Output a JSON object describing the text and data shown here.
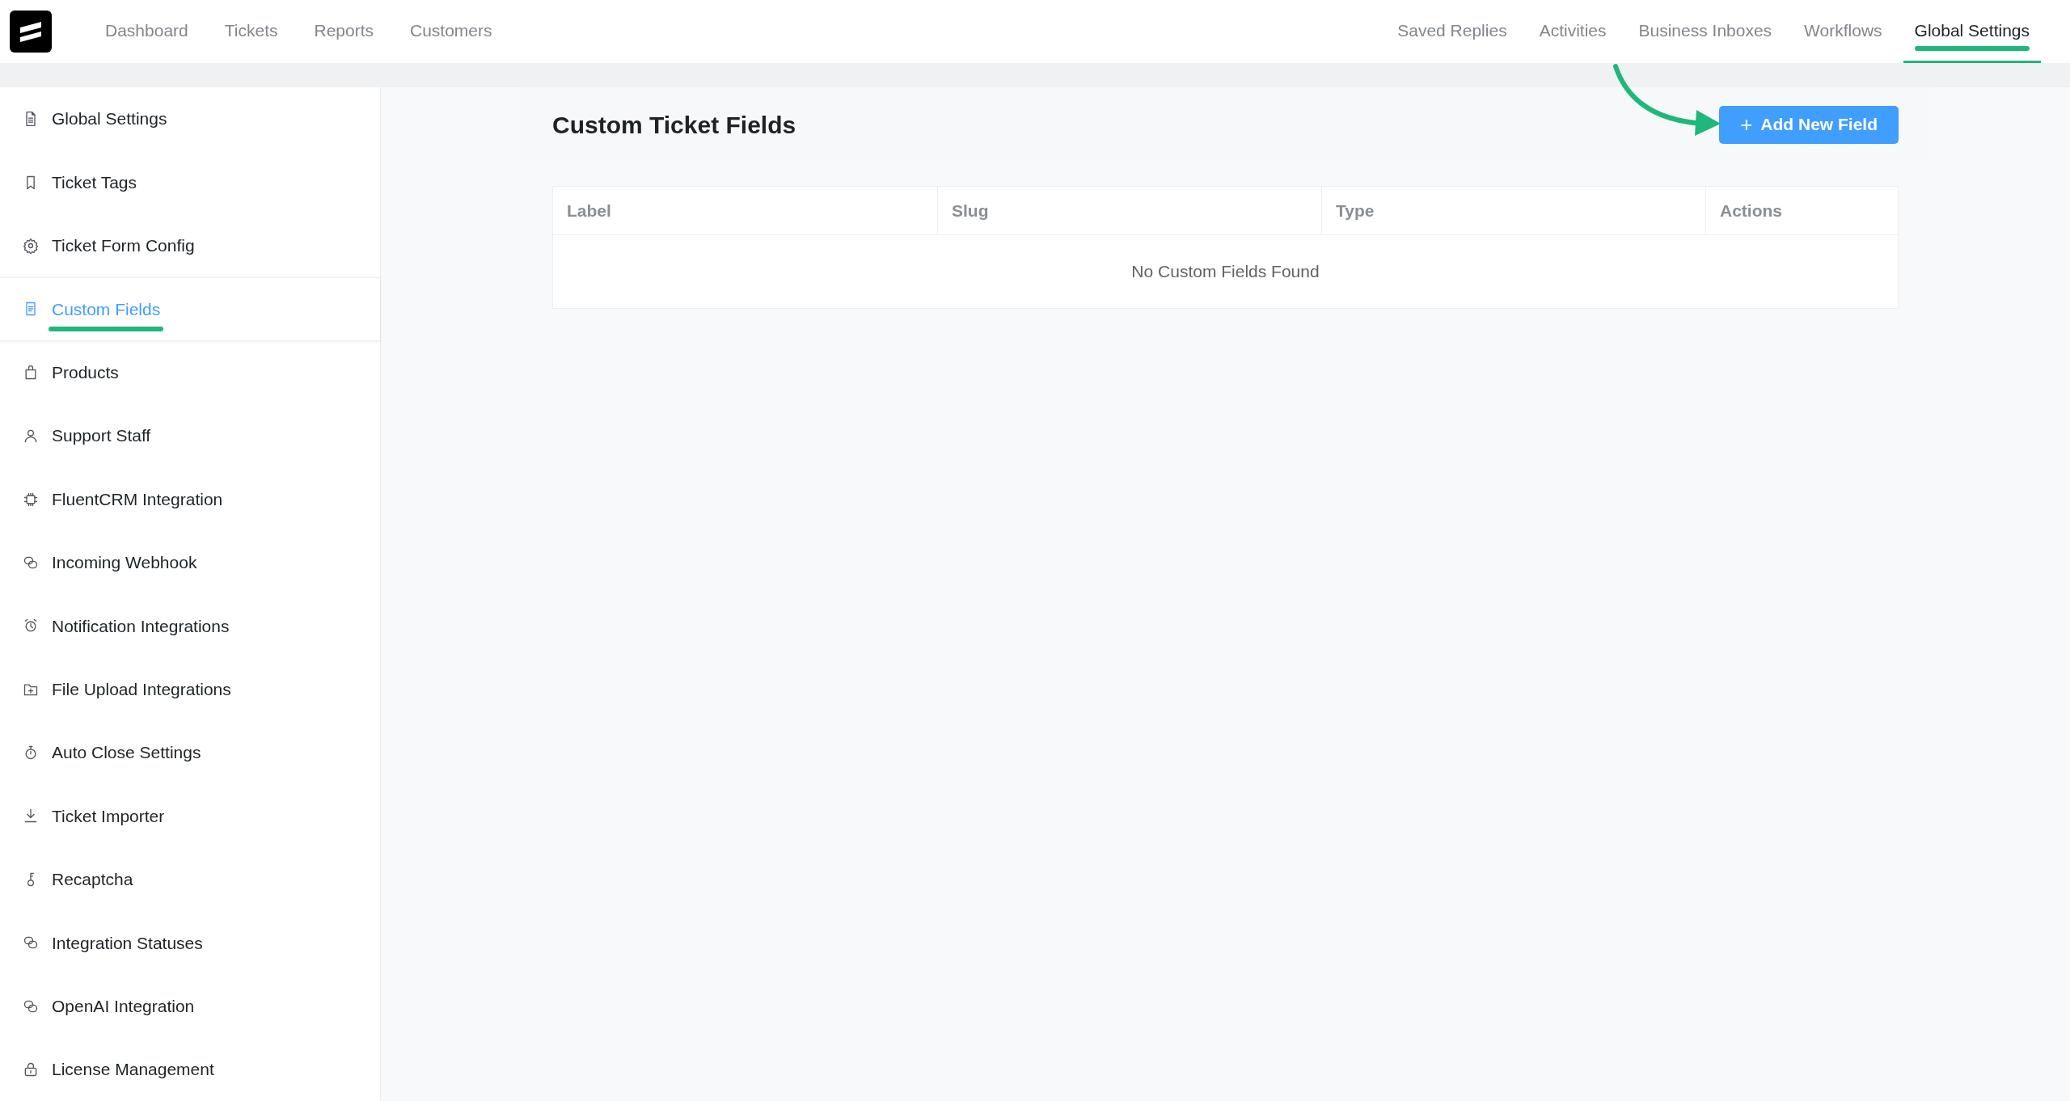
{
  "top_nav": {
    "left": [
      {
        "label": "Dashboard",
        "selected": false
      },
      {
        "label": "Tickets",
        "selected": false
      },
      {
        "label": "Reports",
        "selected": false
      },
      {
        "label": "Customers",
        "selected": false
      }
    ],
    "right": [
      {
        "label": "Saved Replies",
        "selected": false
      },
      {
        "label": "Activities",
        "selected": false
      },
      {
        "label": "Business Inboxes",
        "selected": false
      },
      {
        "label": "Workflows",
        "selected": false
      },
      {
        "label": "Global Settings",
        "selected": true
      }
    ]
  },
  "sidebar": {
    "items": [
      {
        "label": "Global Settings",
        "selected": false
      },
      {
        "label": "Ticket Tags",
        "selected": false
      },
      {
        "label": "Ticket Form Config",
        "selected": false
      },
      {
        "label": "Custom Fields",
        "selected": true
      },
      {
        "label": "Products",
        "selected": false
      },
      {
        "label": "Support Staff",
        "selected": false
      },
      {
        "label": "FluentCRM Integration",
        "selected": false
      },
      {
        "label": "Incoming Webhook",
        "selected": false
      },
      {
        "label": "Notification Integrations",
        "selected": false
      },
      {
        "label": "File Upload Integrations",
        "selected": false
      },
      {
        "label": "Auto Close Settings",
        "selected": false
      },
      {
        "label": "Ticket Importer",
        "selected": false
      },
      {
        "label": "Recaptcha",
        "selected": false
      },
      {
        "label": "Integration Statuses",
        "selected": false
      },
      {
        "label": "OpenAI Integration",
        "selected": false
      },
      {
        "label": "License Management",
        "selected": false
      }
    ]
  },
  "page": {
    "title": "Custom Ticket Fields",
    "add_button": {
      "icon": "+",
      "label": "Add New Field"
    },
    "table": {
      "columns": [
        "Label",
        "Slug",
        "Type",
        "Actions"
      ],
      "empty_text": "No Custom Fields Found"
    }
  }
}
